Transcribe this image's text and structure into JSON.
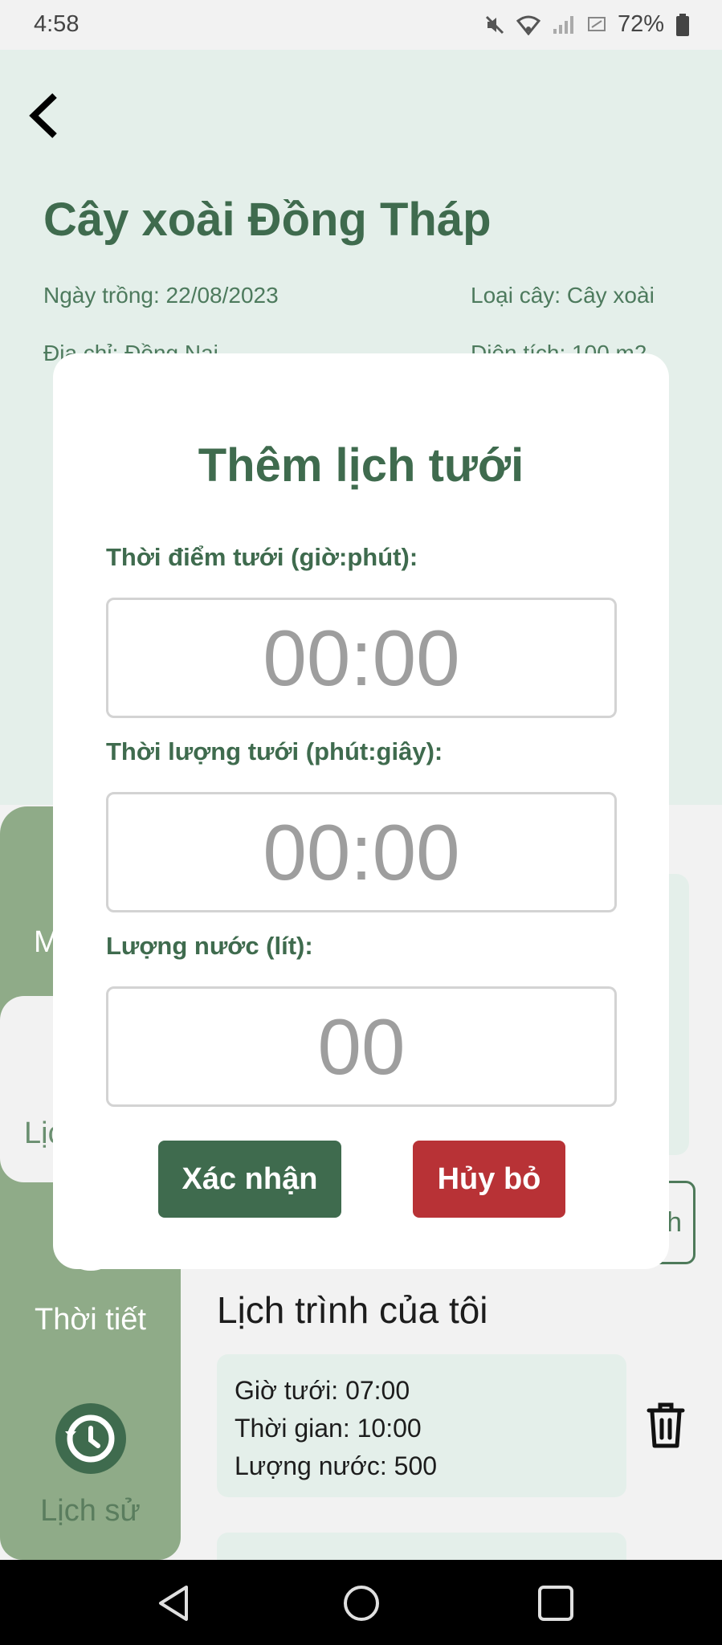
{
  "status_bar": {
    "time": "4:58",
    "battery": "72%"
  },
  "plant": {
    "title": "Cây xoài Đồng Tháp",
    "planted": "Ngày trồng: 22/08/2023",
    "type": "Loại cây: Cây xoài",
    "address": "Địa chỉ: Đồng Nai",
    "area": "Diện tích: 100 m2"
  },
  "sidebar": {
    "partial_top": "M",
    "partial_active": "Lịc",
    "weather": "Thời tiết",
    "history": "Lịch sử"
  },
  "partial_button_text": "h",
  "schedule": {
    "title": "Lịch trình của tôi",
    "items": [
      {
        "time": "Giờ tưới: 07:00",
        "duration": "Thời gian: 10:00",
        "water": "Lượng nước: 500"
      }
    ]
  },
  "dialog": {
    "title": "Thêm lịch tưới",
    "time_label": "Thời điểm tưới (giờ:phút):",
    "time_placeholder": "00:00",
    "duration_label": "Thời lượng tưới (phút:giây):",
    "duration_placeholder": "00:00",
    "water_label": "Lượng nước (lít):",
    "water_placeholder": "00",
    "confirm": "Xác nhận",
    "cancel": "Hủy bỏ"
  },
  "colors": {
    "primary": "#3f6b4e",
    "danger": "#b83236",
    "sidebar": "#8fab88",
    "surface": "#e4efea"
  },
  "icons": [
    "back-arrow-icon",
    "mute-icon",
    "wifi-icon",
    "signal-icon",
    "sim-icon",
    "battery-icon",
    "weather-icon",
    "history-icon",
    "trash-icon",
    "nav-back-icon",
    "nav-home-icon",
    "nav-recents-icon"
  ]
}
